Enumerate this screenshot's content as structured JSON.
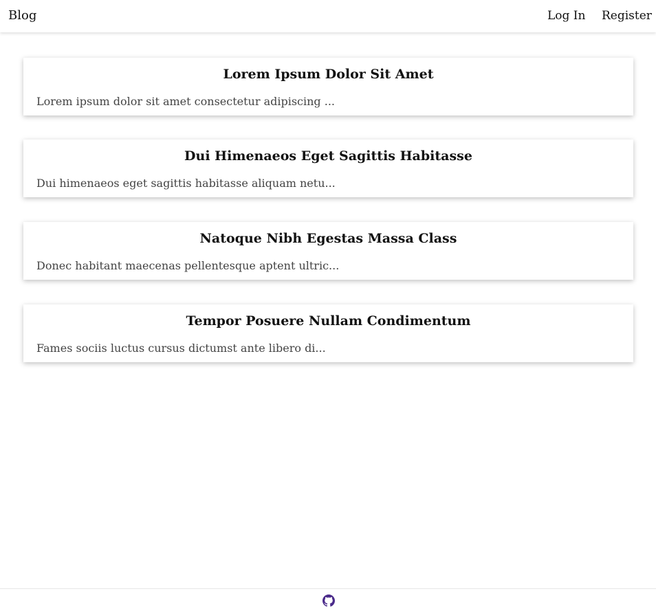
{
  "header": {
    "brand": "Blog",
    "login_label": "Log In",
    "register_label": "Register"
  },
  "posts": [
    {
      "title": "Lorem Ipsum Dolor Sit Amet",
      "excerpt": "Lorem ipsum dolor sit amet consectetur adipiscing ..."
    },
    {
      "title": "Dui Himenaeos Eget Sagittis Habitasse",
      "excerpt": "Dui himenaeos eget sagittis habitasse aliquam netu..."
    },
    {
      "title": "Natoque Nibh Egestas Massa Class",
      "excerpt": "Donec habitant maecenas pellentesque aptent ultric..."
    },
    {
      "title": "Tempor Posuere Nullam Condimentum",
      "excerpt": "Fames sociis luctus cursus dictumst ante libero di..."
    }
  ],
  "footer": {
    "icon": "github-icon",
    "icon_color": "#4a2a8a"
  }
}
